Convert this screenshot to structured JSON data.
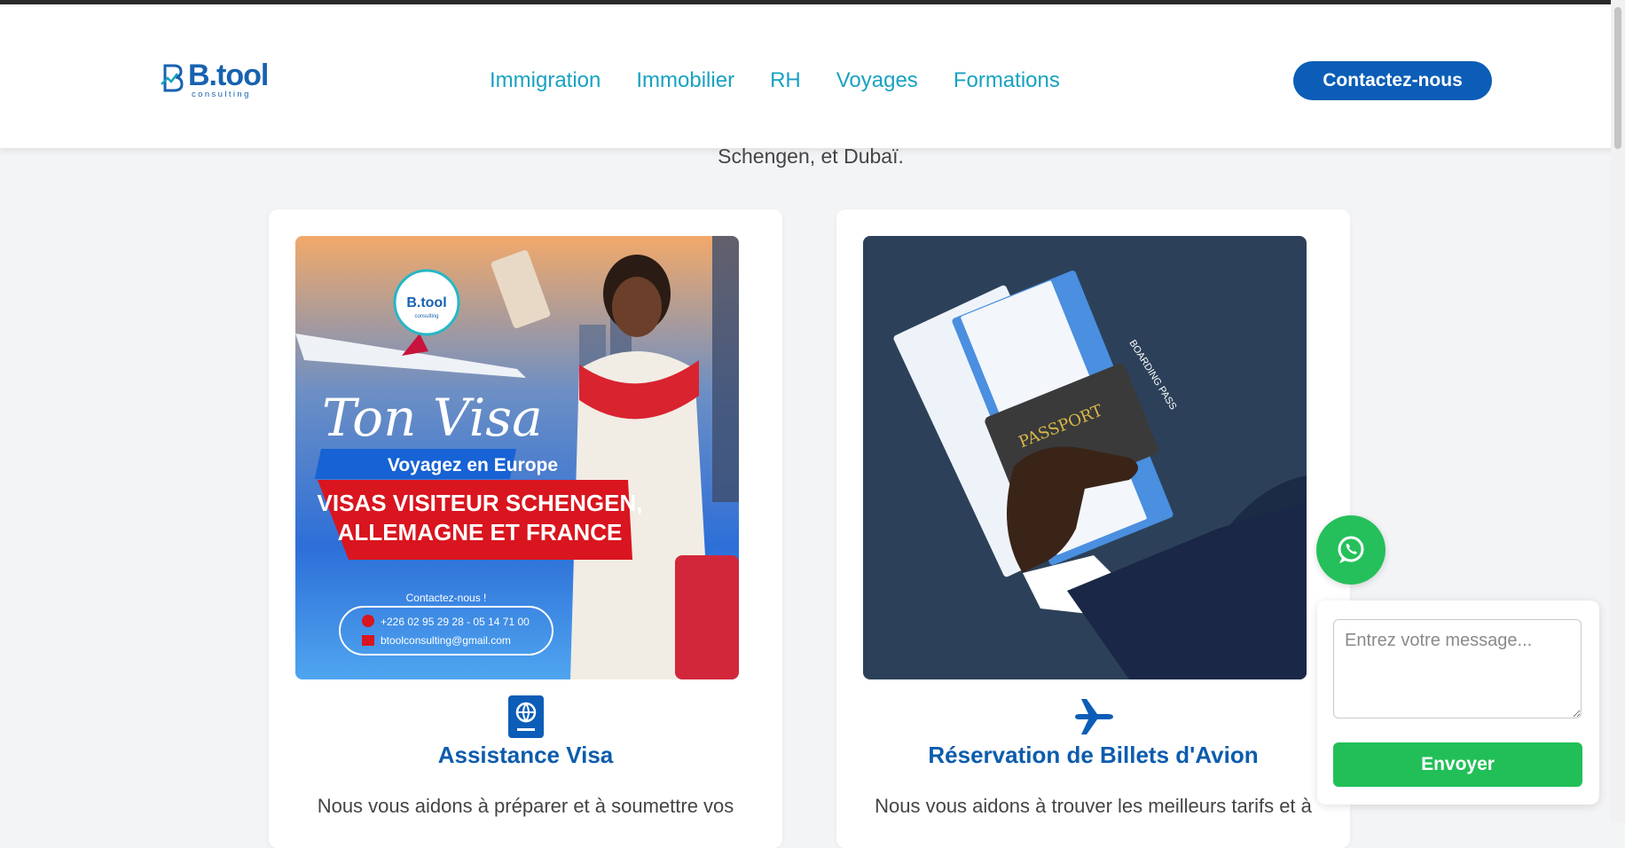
{
  "header": {
    "logo": {
      "name": "B.tool",
      "subtitle": "consulting"
    },
    "nav": [
      "Immigration",
      "Immobilier",
      "RH",
      "Voyages",
      "Formations"
    ],
    "cta_label": "Contactez-nous"
  },
  "intro_text": "Schengen, et Dubaï.",
  "cards": [
    {
      "title": "Assistance Visa",
      "text": "Nous vous aidons à préparer et à soumettre vos",
      "icon": "passport-icon",
      "image": {
        "logo_name": "B.tool",
        "logo_sub": "consulting",
        "script_title": "Ton Visa",
        "banner_top": "Voyagez en Europe",
        "banner_line1": "VISAS VISITEUR SCHENGEN,",
        "banner_line2": "ALLEMAGNE ET FRANCE",
        "contact_label": "Contactez-nous !",
        "phone": "+226 02 95 29 28 - 05 14 71 00",
        "email": "btoolconsulting@gmail.com"
      }
    },
    {
      "title": "Réservation de Billets d'Avion",
      "text": "Nous vous aidons à trouver les meilleurs tarifs et à",
      "icon": "plane-icon",
      "image": {
        "passport_label": "PASSPORT",
        "ticket_label": "BOARDING PASS"
      }
    }
  ],
  "chat": {
    "placeholder": "Entrez votre message...",
    "send_label": "Envoyer"
  },
  "colors": {
    "primary": "#0b5db7",
    "nav": "#17a2c2",
    "whatsapp": "#25c05b",
    "title": "#0d5cad"
  }
}
